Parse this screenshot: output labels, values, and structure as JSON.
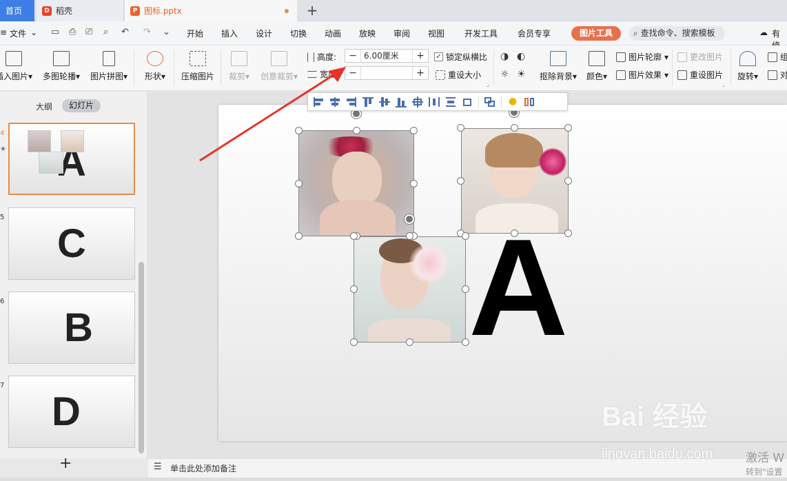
{
  "tabs": {
    "home": "首页",
    "docer": "稻壳",
    "file": "图标.pptx",
    "new": "+"
  },
  "menu": {
    "file": "文件",
    "items": [
      "开始",
      "插入",
      "设计",
      "切换",
      "动画",
      "放映",
      "审阅",
      "视图",
      "开发工具",
      "会员专享"
    ],
    "picture_tools": "图片工具",
    "search": "查找命令、搜索模板",
    "right_cut": "有修"
  },
  "ribbon": {
    "insert_picture": "插入图片",
    "multi_carousel": "多图轮播",
    "picture_collage": "图片拼图",
    "shape": "形状",
    "compress": "压缩图片",
    "crop": "裁剪",
    "creative_crop": "创意裁剪",
    "height_label": "高度:",
    "height_value": "6.00厘米",
    "width_label": "宽度:",
    "width_value": "",
    "lock_ratio": "锁定纵横比",
    "reset_size": "重设大小",
    "remove_bg": "抠除背景",
    "color": "颜色",
    "outline": "图片轮廓",
    "effect": "图片效果",
    "change_picture": "更改图片",
    "reset_picture": "重设图片",
    "rotate": "旋转",
    "right_cut1": "组",
    "right_cut2": "对"
  },
  "left_panel": {
    "outline": "大纲",
    "slides": "幻灯片",
    "slides_list": [
      {
        "num": "4",
        "letter": "A"
      },
      {
        "num": "5",
        "letter": "C"
      },
      {
        "num": "6",
        "letter": "B"
      },
      {
        "num": "7",
        "letter": "D"
      }
    ],
    "add": "+"
  },
  "slide": {
    "big_letter": "A"
  },
  "notes": {
    "placeholder": "单击此处添加备注"
  },
  "watermark": {
    "brand": "Bai 经验",
    "url": "jingyan.baidu.com",
    "activate": "激活 W",
    "activate_sub": "转到\"设置"
  },
  "colors": {
    "accent": "#3d7fe6",
    "picture_tools": "#e9704d",
    "arrow": "#e8322a",
    "selected_thumb": "#e28b4a"
  }
}
